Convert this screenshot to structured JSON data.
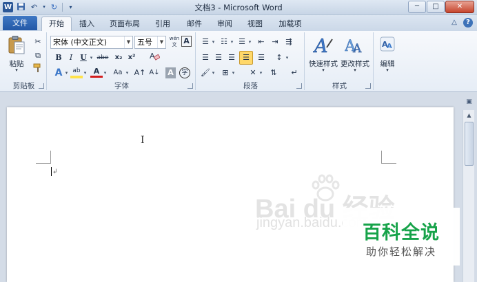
{
  "window": {
    "title": "文档3 - Microsoft Word",
    "logo_letter": "W",
    "controls": {
      "minimize": "─",
      "maximize": "□",
      "close": "✕"
    }
  },
  "quick_access": [
    {
      "name": "save-icon",
      "glyph": "💾"
    },
    {
      "name": "undo-icon",
      "glyph": "↶"
    },
    {
      "name": "redo-icon",
      "glyph": "↻"
    },
    {
      "name": "customize-icon",
      "glyph": "▾"
    }
  ],
  "tabs": {
    "file": "文件",
    "items": [
      "开始",
      "插入",
      "页面布局",
      "引用",
      "邮件",
      "审阅",
      "视图",
      "加载项"
    ],
    "active_index": 0,
    "help": "?",
    "minimize_ribbon": "△"
  },
  "ribbon": {
    "clipboard": {
      "label": "剪贴板",
      "paste": "粘贴"
    },
    "font": {
      "label": "字体",
      "font_name": "宋体 (中文正文)",
      "font_size": "五号",
      "bold": "B",
      "italic": "I",
      "underline": "U",
      "strikethrough": "abe",
      "subscript": "x₂",
      "superscript": "x²",
      "grow": "A↑",
      "shrink": "A↓",
      "change_case": "Aa",
      "char_border": "A",
      "char_shading": "A",
      "enclose": "字",
      "phonetic": "wén"
    },
    "paragraph": {
      "label": "段落"
    },
    "styles": {
      "label": "样式",
      "quick_styles": "快速样式",
      "change_styles": "更改样式"
    },
    "editing": {
      "label": "编辑"
    }
  },
  "document": {
    "watermark_logo": "Bai du 经验",
    "watermark_url": "jingyan.baidu.com",
    "badge_title": "百科全说",
    "badge_sub": "助你轻松解决"
  },
  "colors": {
    "file_tab": "#2358a6",
    "highlight": "#ffe24a",
    "font_color": "#d21e1e",
    "badge_green": "#17a34a"
  }
}
